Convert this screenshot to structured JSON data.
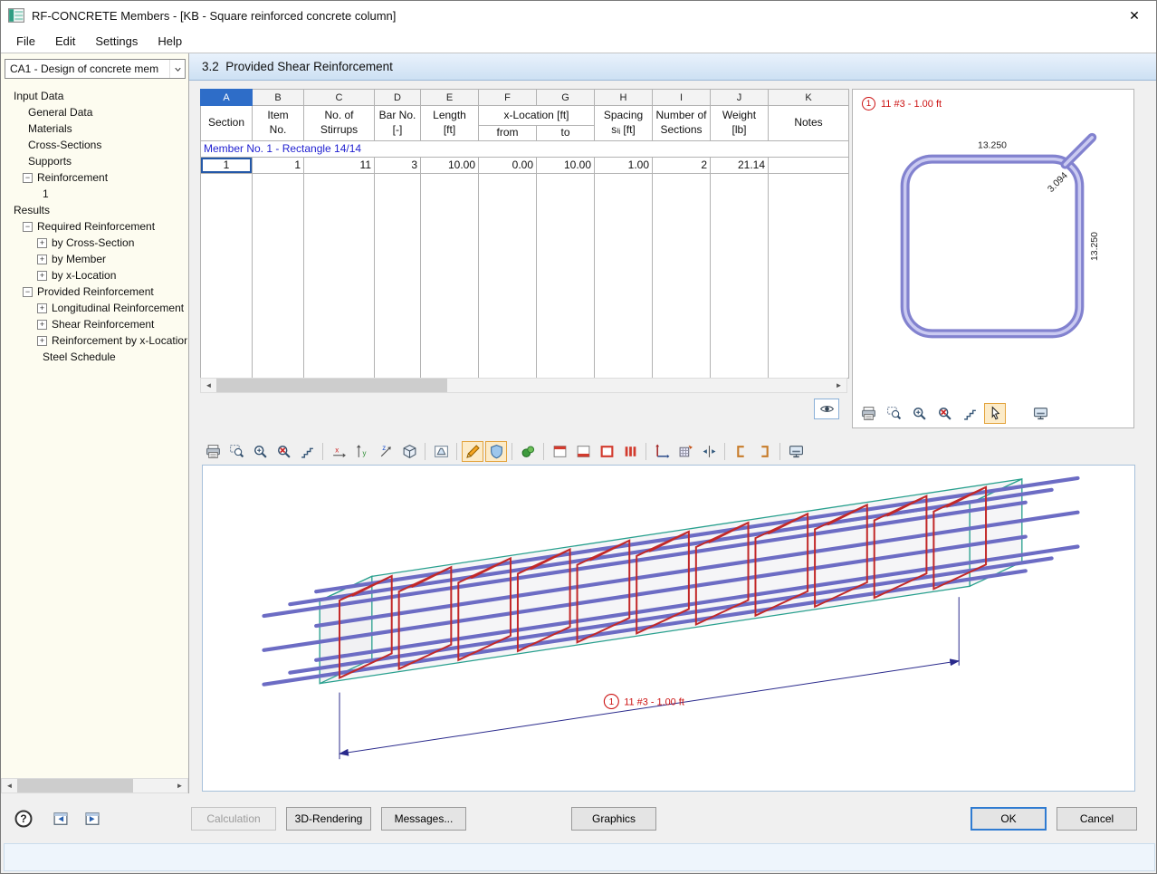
{
  "window": {
    "title": "RF-CONCRETE Members - [KB - Square reinforced concrete column]",
    "close_glyph": "✕"
  },
  "menu": [
    "File",
    "Edit",
    "Settings",
    "Help"
  ],
  "sidebar": {
    "case_selector": "CA1 - Design of concrete mem",
    "tree": [
      {
        "label": "Input Data",
        "level": 0,
        "box": "none"
      },
      {
        "label": "General Data",
        "level": 1,
        "box": "none"
      },
      {
        "label": "Materials",
        "level": 1,
        "box": "none"
      },
      {
        "label": "Cross-Sections",
        "level": 1,
        "box": "none"
      },
      {
        "label": "Supports",
        "level": 1,
        "box": "none"
      },
      {
        "label": "Reinforcement",
        "level": 1,
        "box": "minus"
      },
      {
        "label": "1",
        "level": 2,
        "box": "none"
      },
      {
        "label": "Results",
        "level": 0,
        "box": "none"
      },
      {
        "label": "Required Reinforcement",
        "level": 1,
        "box": "minus"
      },
      {
        "label": "by Cross-Section",
        "level": 2,
        "box": "plus"
      },
      {
        "label": "by Member",
        "level": 2,
        "box": "plus"
      },
      {
        "label": "by x-Location",
        "level": 2,
        "box": "plus"
      },
      {
        "label": "Provided Reinforcement",
        "level": 1,
        "box": "minus"
      },
      {
        "label": "Longitudinal Reinforcement",
        "level": 2,
        "box": "plus"
      },
      {
        "label": "Shear Reinforcement",
        "level": 2,
        "box": "plus"
      },
      {
        "label": "Reinforcement by x-Location",
        "level": 2,
        "box": "plus"
      },
      {
        "label": "Steel Schedule",
        "level": 2,
        "box": "none"
      }
    ]
  },
  "content": {
    "section_title": "3.2  Provided Shear Reinforcement",
    "table": {
      "columns": [
        {
          "letter": "A",
          "lines": [
            "Section"
          ],
          "selected": true
        },
        {
          "letter": "B",
          "lines": [
            "Item",
            "No."
          ]
        },
        {
          "letter": "C",
          "lines": [
            "No. of",
            "Stirrups"
          ]
        },
        {
          "letter": "D",
          "lines": [
            "Bar No.",
            "[-]"
          ]
        },
        {
          "letter": "E",
          "lines": [
            "Length",
            "[ft]"
          ]
        },
        {
          "letter": "F",
          "lines": [
            "from"
          ],
          "group": "x-Location [ft]"
        },
        {
          "letter": "G",
          "lines": [
            "to"
          ],
          "group": "x-Location [ft]"
        },
        {
          "letter": "H",
          "lines": [
            "Spacing",
            "sₗᵢ [ft]"
          ]
        },
        {
          "letter": "I",
          "lines": [
            "Number of",
            "Sections"
          ]
        },
        {
          "letter": "J",
          "lines": [
            "Weight",
            "[lb]"
          ]
        },
        {
          "letter": "K",
          "lines": [
            "Notes"
          ]
        }
      ],
      "group_label": "Member No. 1 - Rectangle 14/14",
      "rows": [
        [
          "1",
          "1",
          "11",
          "3",
          "10.00",
          "0.00",
          "10.00",
          "1.00",
          "2",
          "21.14",
          ""
        ]
      ]
    }
  },
  "detail": {
    "marker": "1",
    "label": "11 #3 - 1.00 ft",
    "dim_top": "13.250",
    "dim_right": "13.250",
    "dim_hook": "3.094"
  },
  "render": {
    "stirrup_count": 11,
    "marker": "1",
    "dim_label": "11 #3 - 1.00 ft"
  },
  "toolbars": {
    "detail": [
      {
        "name": "print"
      },
      {
        "name": "zoom-window"
      },
      {
        "name": "zoom-in"
      },
      {
        "name": "zoom-cancel"
      },
      {
        "name": "steps"
      },
      {
        "name": "pointer",
        "selected": true
      },
      {
        "name": "display-options",
        "push_right": true
      }
    ],
    "view": [
      {
        "name": "print"
      },
      {
        "name": "zoom-window"
      },
      {
        "name": "zoom-in"
      },
      {
        "name": "zoom-cancel"
      },
      {
        "name": "steps"
      },
      {
        "sep": true
      },
      {
        "name": "move-x"
      },
      {
        "name": "move-y"
      },
      {
        "name": "move-z"
      },
      {
        "name": "isometric"
      },
      {
        "sep": true
      },
      {
        "name": "projection"
      },
      {
        "sep": true
      },
      {
        "name": "render-mode",
        "selected": true
      },
      {
        "name": "transparency",
        "selected": true
      },
      {
        "sep": true
      },
      {
        "name": "materials"
      },
      {
        "sep": true
      },
      {
        "name": "view-top"
      },
      {
        "name": "view-bottom"
      },
      {
        "name": "view-frame"
      },
      {
        "name": "view-columns"
      },
      {
        "sep": true
      },
      {
        "name": "axes"
      },
      {
        "name": "section-grid"
      },
      {
        "name": "compress"
      },
      {
        "sep": true
      },
      {
        "name": "clip-start"
      },
      {
        "name": "clip-end"
      },
      {
        "sep": true
      },
      {
        "name": "display-options"
      }
    ]
  },
  "footer": {
    "calculation": "Calculation",
    "rendering": "3D-Rendering",
    "messages": "Messages...",
    "graphics": "Graphics",
    "ok": "OK",
    "cancel": "Cancel"
  }
}
